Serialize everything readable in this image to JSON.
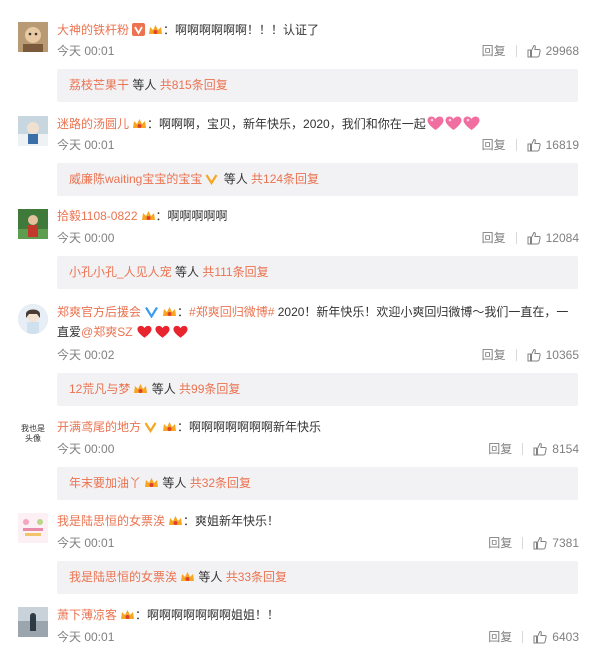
{
  "comments": [
    {
      "user": "大神的铁杆粉",
      "text": "：啊啊啊啊啊啊！！！认证了",
      "time": "今天 00:01",
      "reply_label": "回复",
      "likes": "29968",
      "sub_user": "荔枝芒果干",
      "sub_mid": " 等人 ",
      "sub_total": "共815条回复"
    },
    {
      "user": "迷路的汤圆儿",
      "text": "：啊啊啊，宝贝，新年快乐，2020，我们和你在一起",
      "time": "今天 00:01",
      "reply_label": "回复",
      "likes": "16819",
      "sub_user": "威廉陈waiting宝宝的宝宝",
      "sub_mid": " 等人 ",
      "sub_total": "共124条回复"
    },
    {
      "user": "拾毅1108-0822",
      "text": "：啊啊啊啊啊",
      "time": "今天 00:00",
      "reply_label": "回复",
      "likes": "12084",
      "sub_user": "小孔小孔_人见人宠",
      "sub_mid": " 等人 ",
      "sub_total": "共111条回复"
    },
    {
      "user": "郑爽官方后援会",
      "hashtag": "#郑爽回归微博#",
      "text_a": "：",
      "text_b": " 2020！新年快乐！欢迎小爽回归微博～我们一直在，一",
      "text_c": "直爱",
      "mention": "@郑爽SZ",
      "time": "今天 00:02",
      "reply_label": "回复",
      "likes": "10365",
      "sub_user": "12荒凡与梦",
      "sub_mid": " 等人 ",
      "sub_total": "共99条回复"
    },
    {
      "user": "开满鸢尾的地方",
      "text": "：啊啊啊啊啊啊啊新年快乐",
      "time": "今天 00:00",
      "reply_label": "回复",
      "likes": "8154",
      "avatar_text": "我也是头像",
      "sub_user": "年末要加油丫",
      "sub_mid": " 等人 ",
      "sub_total": "共32条回复"
    },
    {
      "user": "我是陆思恒的女票涘",
      "text": "：爽姐新年快乐！",
      "time": "今天 00:01",
      "reply_label": "回复",
      "likes": "7381",
      "sub_user": "我是陆思恒的女票涘",
      "sub_mid": " 等人 ",
      "sub_total": "共33条回复"
    },
    {
      "user": "萧下薄凉客",
      "text": "：啊啊啊啊啊啊啊姐姐！！",
      "time": "今天 00:01",
      "reply_label": "回复",
      "likes": "6403"
    }
  ],
  "colors": {
    "accent": "#eb7350",
    "meta": "#808080",
    "sub_bg": "#f2f2f5",
    "verified_gold": "#f6a623",
    "verified_blue": "#3c9dee"
  },
  "icons": [
    "like-icon",
    "verified-icon",
    "vip-crown-icon",
    "heart-emoji"
  ]
}
